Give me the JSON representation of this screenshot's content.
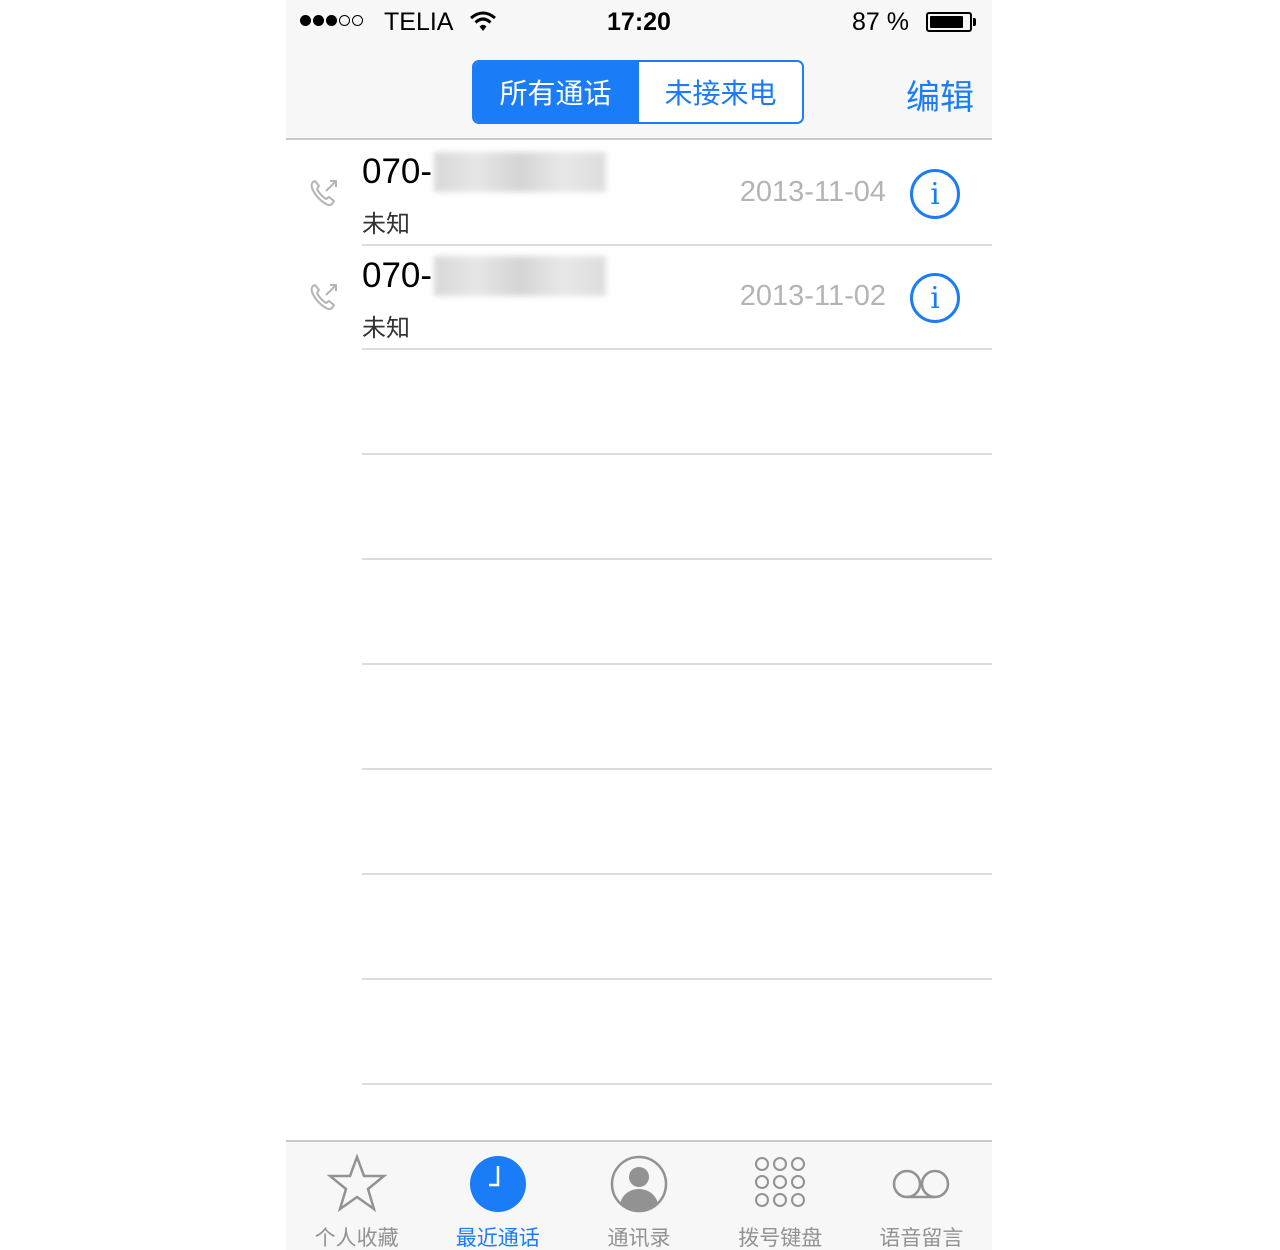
{
  "status_bar": {
    "carrier": "TELIA",
    "time": "17:20",
    "battery_percent": "87 %",
    "battery_level": 0.87,
    "signal_bars_filled": 3,
    "signal_bars_total": 5
  },
  "nav": {
    "segments": [
      {
        "label": "所有通话",
        "active": true
      },
      {
        "label": "未接来电",
        "active": false
      }
    ],
    "edit_label": "编辑"
  },
  "calls": [
    {
      "number": "070-",
      "label": "未知",
      "date": "2013-11-04",
      "icon": "outgoing-call-icon"
    },
    {
      "number": "070-",
      "label": "未知",
      "date": "2013-11-02",
      "icon": "outgoing-call-icon"
    }
  ],
  "info_glyph": "i",
  "tabs": [
    {
      "label": "个人收藏",
      "icon": "star-icon",
      "active": false
    },
    {
      "label": "最近通话",
      "icon": "clock-icon",
      "active": true
    },
    {
      "label": "通讯录",
      "icon": "contacts-icon",
      "active": false
    },
    {
      "label": "拨号键盘",
      "icon": "keypad-icon",
      "active": false
    },
    {
      "label": "语音留言",
      "icon": "voicemail-icon",
      "active": false
    }
  ],
  "colors": {
    "accent": "#1a7cf7",
    "bar_background": "#f7f7f8",
    "date_text": "#b4b4b8",
    "inactive_tab": "#929292"
  }
}
